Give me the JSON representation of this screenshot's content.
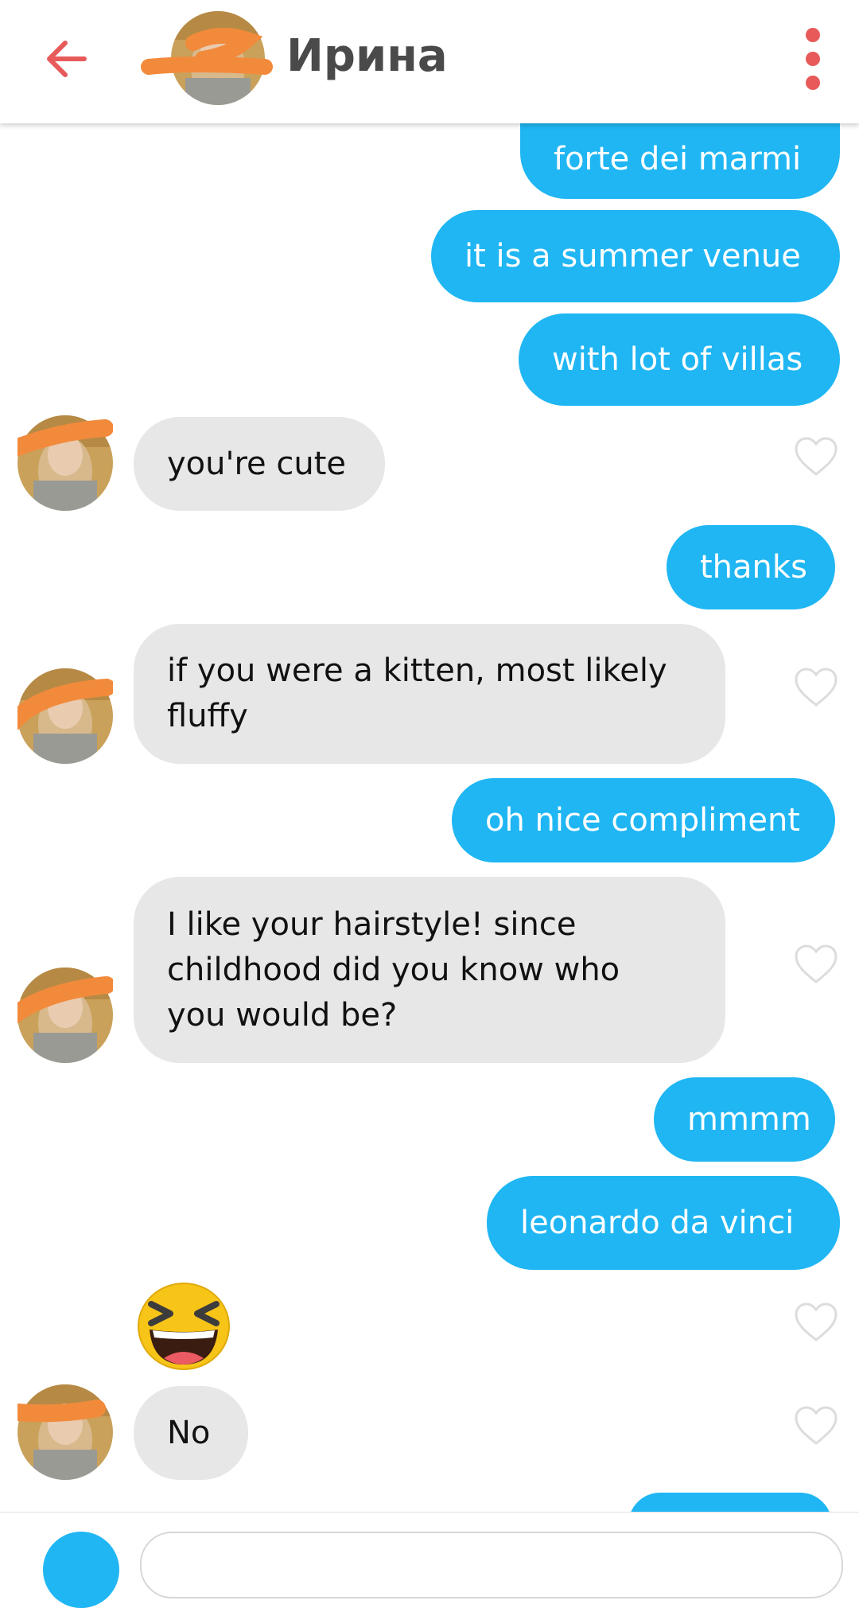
{
  "header": {
    "title": "Ирина",
    "accent_color": "#e85a5a",
    "back_icon": "arrow-left-icon",
    "menu_icon": "more-vertical-icon"
  },
  "messages": [
    {
      "from": "me",
      "text": "forte dei marmi"
    },
    {
      "from": "me",
      "text": "it is a summer venue"
    },
    {
      "from": "me",
      "text": "with lot of villas"
    },
    {
      "from": "match",
      "text": "you're cute"
    },
    {
      "from": "me",
      "text": "thanks"
    },
    {
      "from": "match",
      "text": "if you were a kitten, most likely\nfluffy"
    },
    {
      "from": "me",
      "text": "oh nice compliment"
    },
    {
      "from": "match",
      "text": "I like your hairstyle! since\nchildhood did you know who\nyou would be?"
    },
    {
      "from": "me",
      "text": "mmmm"
    },
    {
      "from": "me",
      "text": "leonardo da vinci"
    },
    {
      "from": "match",
      "text": "",
      "emoji": "laughing-face-emoji"
    },
    {
      "from": "match",
      "text": "No"
    }
  ],
  "colors": {
    "outgoing_bubble": "#1fb6f3",
    "incoming_bubble": "#e7e7e7",
    "heart_outline": "#dcdcdc"
  }
}
